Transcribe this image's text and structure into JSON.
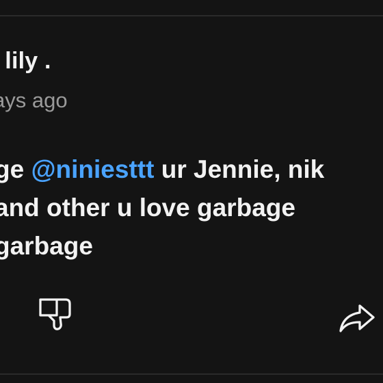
{
  "comment": {
    "author": ". lily .",
    "time": "ays ago",
    "text": {
      "line1_prefix": "ge ",
      "mention": "@niniesttt",
      "line1_suffix": "  ur Jennie, nik",
      "line2": " and other u love garbage",
      "line3": "garbage"
    },
    "icons": {
      "dislike": "thumbs-down-icon",
      "share": "share-arrow-icon"
    },
    "colors": {
      "background": "#141414",
      "text": "#f2f2f2",
      "meta": "#9a9a9a",
      "mention": "#4aa3ff"
    }
  }
}
